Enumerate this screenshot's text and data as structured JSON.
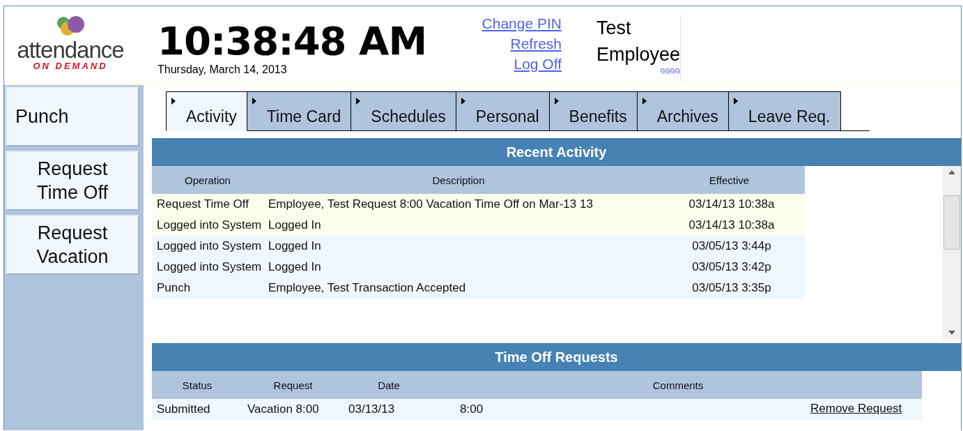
{
  "logo": {
    "name": "attendance",
    "tagline": "ON DEMAND"
  },
  "clock": {
    "time": "10:38:48 AM",
    "date": "Thursday, March 14, 2013"
  },
  "links": [
    "Change PIN",
    "Refresh",
    "Log Off"
  ],
  "user": {
    "first": "Test",
    "last": "Employee",
    "number": "9999"
  },
  "sidebar": {
    "items": [
      {
        "label": "Punch"
      },
      {
        "label": "Request Time Off"
      },
      {
        "label": "Request Vacation"
      }
    ]
  },
  "tabs": [
    {
      "label": "Activity",
      "selected": true
    },
    {
      "label": "Time Card",
      "selected": false
    },
    {
      "label": "Schedules",
      "selected": false
    },
    {
      "label": "Personal",
      "selected": false
    },
    {
      "label": "Benefits",
      "selected": false
    },
    {
      "label": "Archives",
      "selected": false
    },
    {
      "label": "Leave Req.",
      "selected": false
    }
  ],
  "recent_activity": {
    "title": "Recent Activity",
    "columns": [
      "Operation",
      "Description",
      "Effective"
    ],
    "rows": [
      {
        "operation": "Request Time Off",
        "description": "Employee, Test Request 8:00 Vacation Time Off on Mar-13 13",
        "effective": "03/14/13 10:38a",
        "highlighted": true
      },
      {
        "operation": "Logged into System",
        "description": "Logged In",
        "effective": "03/14/13 10:38a",
        "highlighted": true
      },
      {
        "operation": "Logged into System",
        "description": "Logged In",
        "effective": "03/05/13 3:44p",
        "highlighted": false
      },
      {
        "operation": "Logged into System",
        "description": "Logged In",
        "effective": "03/05/13 3:42p",
        "highlighted": false
      },
      {
        "operation": "Punch",
        "description": "Employee, Test Transaction Accepted",
        "effective": "03/05/13 3:35p",
        "highlighted": false
      }
    ]
  },
  "time_off_requests": {
    "title": "Time Off Requests",
    "columns": [
      "Status",
      "Request",
      "Date",
      "Comments"
    ],
    "rows": [
      {
        "status": "Submitted",
        "request": "Vacation 8:00",
        "date": "03/13/13",
        "comments": "8:00",
        "action": "Remove Request"
      }
    ]
  }
}
